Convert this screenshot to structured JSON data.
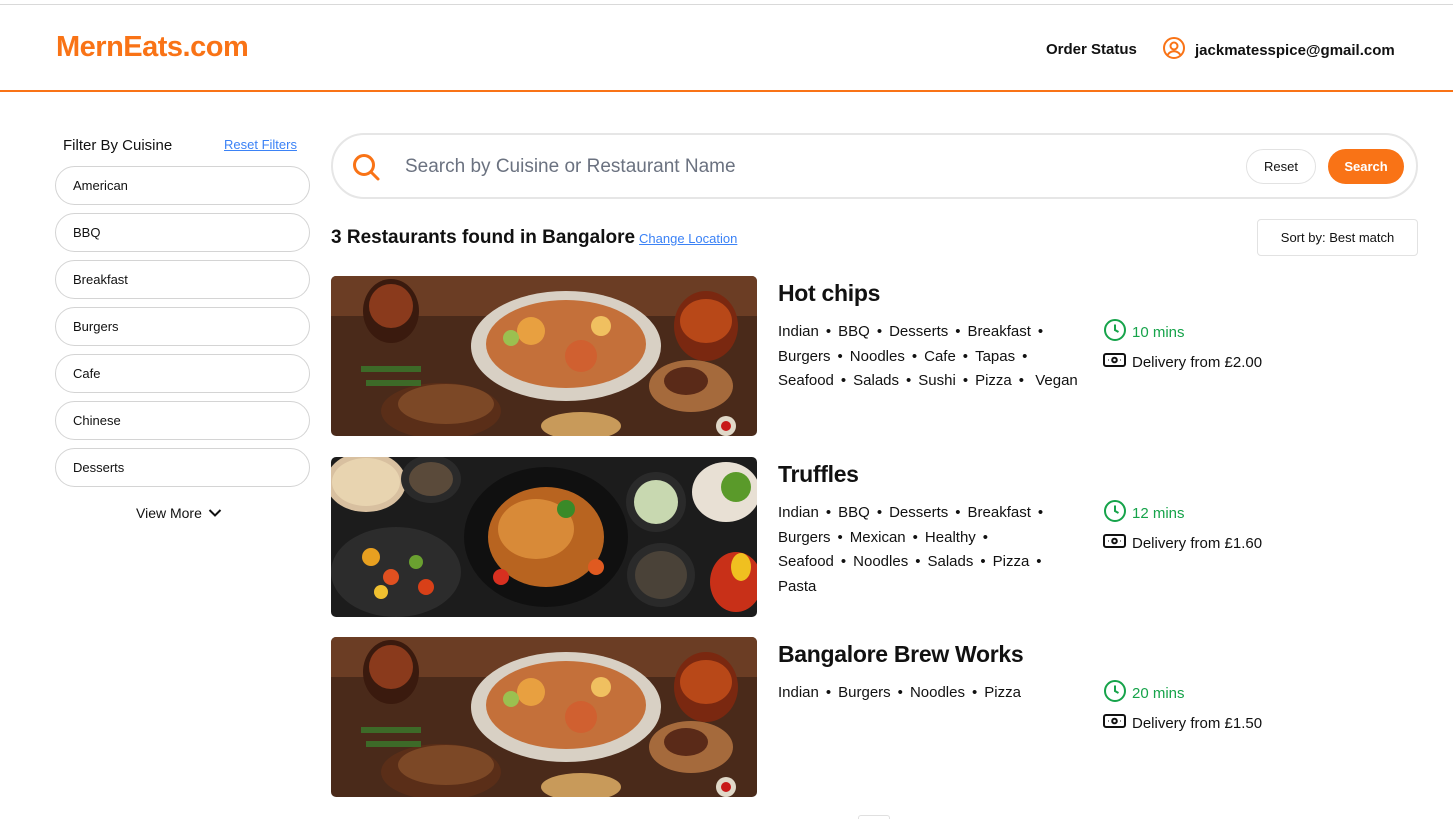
{
  "header": {
    "logo": "MernEats.com",
    "order_status": "Order Status",
    "user_email": "jackmatesspice@gmail.com"
  },
  "sidebar": {
    "title": "Filter By Cuisine",
    "reset_label": "Reset Filters",
    "cuisines": [
      "American",
      "BBQ",
      "Breakfast",
      "Burgers",
      "Cafe",
      "Chinese",
      "Desserts"
    ],
    "view_more": "View More"
  },
  "search": {
    "placeholder": "Search by Cuisine or Restaurant Name",
    "reset_label": "Reset",
    "search_label": "Search"
  },
  "results": {
    "count_text": "3 Restaurants found in Bangalore",
    "change_location": "Change Location",
    "sort_label": "Sort by: Best match"
  },
  "restaurants": [
    {
      "name": "Hot chips",
      "cuisines": [
        "Indian",
        "BBQ",
        "Desserts",
        "Breakfast",
        "Burgers",
        "Noodles",
        "Cafe",
        "Tapas",
        "Seafood",
        "Salads",
        "Sushi",
        "Pizza",
        "Vegan"
      ],
      "time": "10 mins",
      "delivery": "Delivery from £2.00",
      "image": "grill-platter-photo"
    },
    {
      "name": "Truffles",
      "cuisines": [
        "Indian",
        "BBQ",
        "Desserts",
        "Breakfast",
        "Burgers",
        "Mexican",
        "Healthy",
        "Seafood",
        "Noodles",
        "Salads",
        "Pizza",
        "Pasta"
      ],
      "time": "12 mins",
      "delivery": "Delivery from £1.60",
      "image": "roast-chicken-spread-photo"
    },
    {
      "name": "Bangalore Brew Works",
      "cuisines": [
        "Indian",
        "Burgers",
        "Noodles",
        "Pizza"
      ],
      "time": "20 mins",
      "delivery": "Delivery from £1.50",
      "image": "grill-platter-photo"
    }
  ],
  "colors": {
    "accent": "#f97316",
    "link": "#3b82f6",
    "time_green": "#16a34a"
  }
}
